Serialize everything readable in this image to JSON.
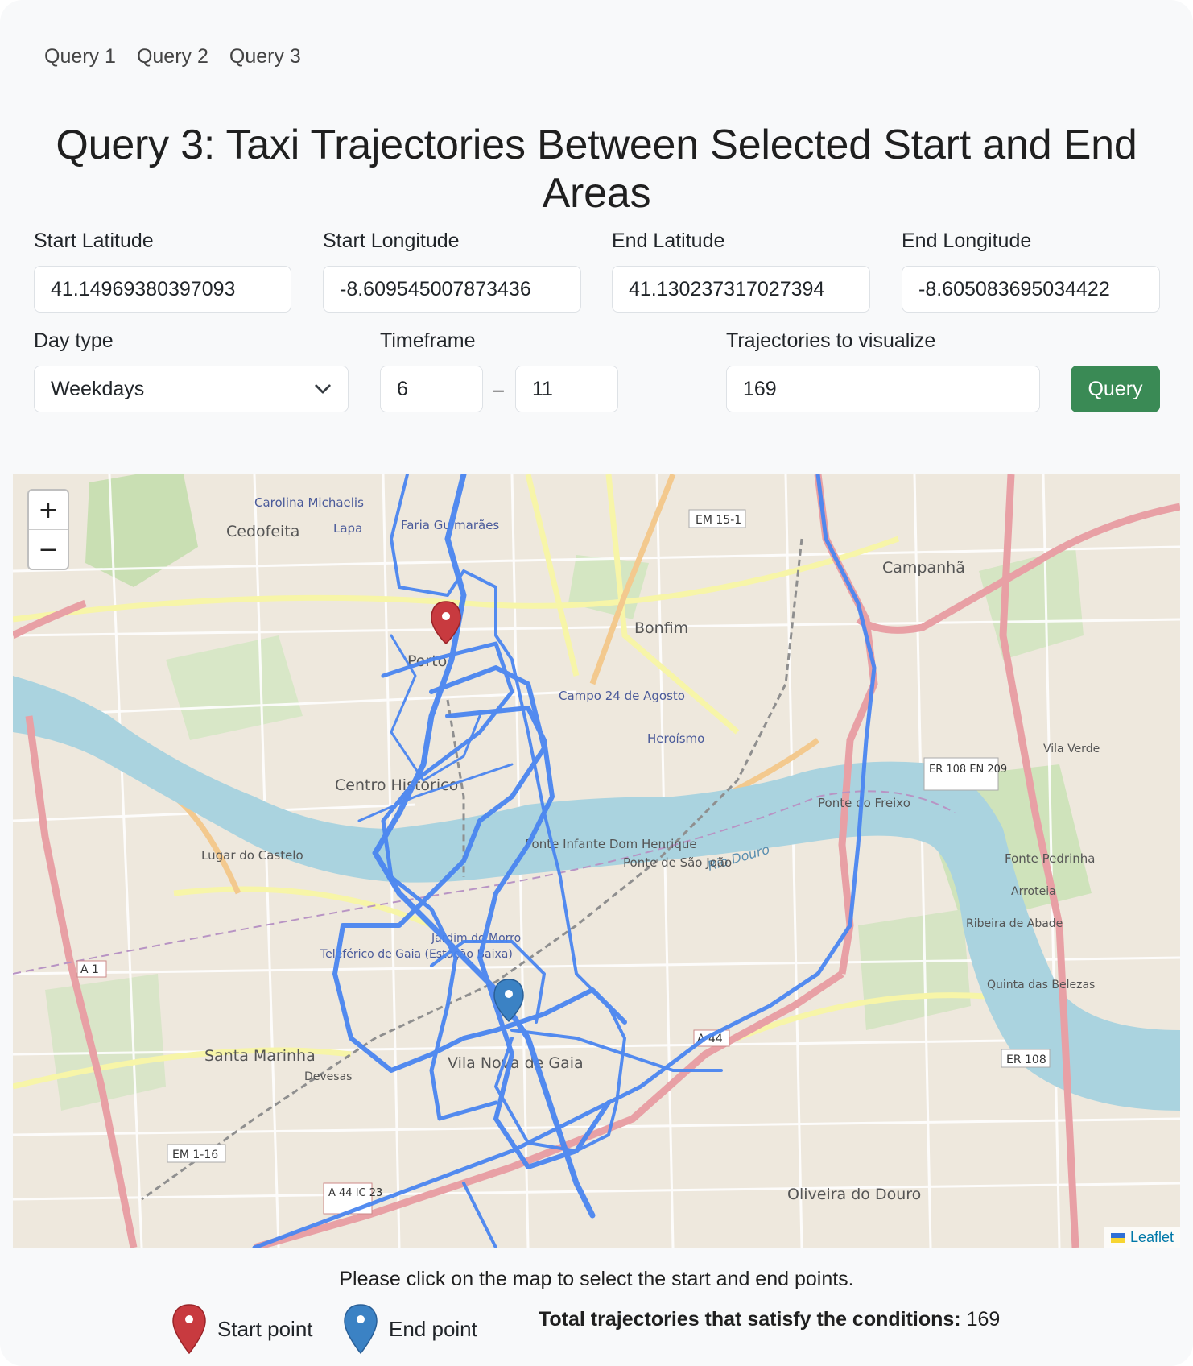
{
  "nav": [
    "Query 1",
    "Query 2",
    "Query 3"
  ],
  "title": "Query 3: Taxi Trajectories Between Selected Start and End Areas",
  "form": {
    "start_lat_label": "Start Latitude",
    "start_lat_value": "41.14969380397093",
    "start_lon_label": "Start Longitude",
    "start_lon_value": "-8.609545007873436",
    "end_lat_label": "End Latitude",
    "end_lat_value": "41.130237317027394",
    "end_lon_label": "End Longitude",
    "end_lon_value": "-8.605083695034422",
    "day_type_label": "Day type",
    "day_type_value": "Weekdays",
    "timeframe_label": "Timeframe",
    "timeframe_from": "6",
    "timeframe_separator": "–",
    "timeframe_to": "11",
    "trajectories_label": "Trajectories to visualize",
    "trajectories_value": "169",
    "query_button": "Query"
  },
  "map": {
    "zoom_in": "+",
    "zoom_out": "−",
    "attribution": "Leaflet",
    "route_color": "#4a86f0",
    "start_marker_color": "#c83a3f",
    "end_marker_color": "#3b82c4",
    "place_labels": {
      "cedofeita": "Cedofeita",
      "carolina": "Carolina Michaelis",
      "lapa": "Lapa",
      "faria": "Faria Guimarães",
      "bonfim": "Bonfim",
      "campanha": "Campanhã",
      "porto": "Porto",
      "campo": "Campo 24 de Agosto",
      "heroismo": "Heroísmo",
      "centro": "Centro Histórico",
      "rio_douro": "Rio Douro",
      "lugar": "Lugar do Castelo",
      "ponte_infante": "Ponte Infante Dom Henrique",
      "ponte_sao_joao": "Ponte de São João",
      "ponte_freixo": "Ponte do Freixo",
      "gaia": "Vila Nova de Gaia",
      "santa_marinha": "Santa Marinha",
      "devesas": "Devesas",
      "teleferico": "Teleférico de Gaia (Estação Baixa)",
      "jardim": "Jardim do Morro",
      "fonte": "Fonte Pedrinha",
      "arroteia": "Arroteia",
      "ribeira": "Ribeira de Abade",
      "quinta": "Quinta das Belezas",
      "oliveira": "Oliveira do Douro",
      "vila_verde": "Vila Verde",
      "em15": "EM 15-1",
      "em116": "EM 1-16",
      "er108a": "ER 108 EN 209",
      "er108b": "ER 108",
      "a1": "A 1",
      "a44": "A 44",
      "a44b": "A 44 IC 23"
    }
  },
  "hint": "Please click on the map to select the start and end points.",
  "legend": {
    "start": "Start point",
    "end": "End point"
  },
  "total": {
    "label": "Total trajectories that satisfy the conditions:",
    "value": "169"
  }
}
